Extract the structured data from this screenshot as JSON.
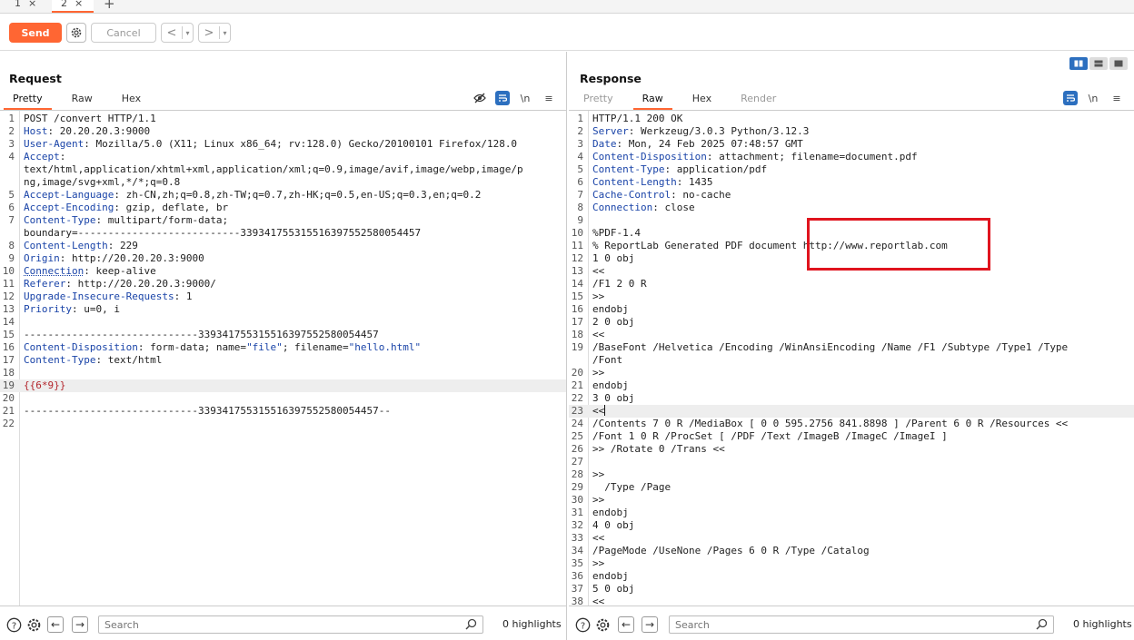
{
  "tabs": [
    {
      "label": "1",
      "close": "×"
    },
    {
      "label": "2",
      "close": "×"
    }
  ],
  "tab_add": "+",
  "toolbar": {
    "send_label": "Send",
    "cancel_label": "Cancel",
    "back_arrow": "<",
    "forward_arrow": ">",
    "dropdown": "▾"
  },
  "request": {
    "title": "Request",
    "tabs": [
      "Pretty",
      "Raw",
      "Hex"
    ],
    "newline_label": "\\n",
    "menu": "≡",
    "lines": [
      {
        "n": "1",
        "t": "POST /convert HTTP/1.1"
      },
      {
        "n": "2",
        "h": "Host",
        "v": ": 20.20.20.3:9000"
      },
      {
        "n": "3",
        "h": "User-Agent",
        "v": ": Mozilla/5.0 (X11; Linux x86_64; rv:128.0) Gecko/20100101 Firefox/128.0"
      },
      {
        "n": "4",
        "h": "Accept",
        "v": ":"
      },
      {
        "n": "",
        "t": "text/html,application/xhtml+xml,application/xml;q=0.9,image/avif,image/webp,image/p"
      },
      {
        "n": "",
        "t": "ng,image/svg+xml,*/*;q=0.8"
      },
      {
        "n": "5",
        "h": "Accept-Language",
        "v": ": zh-CN,zh;q=0.8,zh-TW;q=0.7,zh-HK;q=0.5,en-US;q=0.3,en;q=0.2"
      },
      {
        "n": "6",
        "h": "Accept-Encoding",
        "v": ": gzip, deflate, br"
      },
      {
        "n": "7",
        "h": "Content-Type",
        "v": ": multipart/form-data;"
      },
      {
        "n": "",
        "t": "boundary=---------------------------339341755315516397552580054457"
      },
      {
        "n": "8",
        "h": "Content-Length",
        "v": ": 229"
      },
      {
        "n": "9",
        "h": "Origin",
        "v": ": http://20.20.20.3:9000"
      },
      {
        "n": "10",
        "h": "Connection",
        "v": ": keep-alive",
        "u": true
      },
      {
        "n": "11",
        "h": "Referer",
        "v": ": http://20.20.20.3:9000/"
      },
      {
        "n": "12",
        "h": "Upgrade-Insecure-Requests",
        "v": ": 1"
      },
      {
        "n": "13",
        "h": "Priority",
        "v": ": u=0, i"
      },
      {
        "n": "14",
        "t": ""
      },
      {
        "n": "15",
        "t": "-----------------------------339341755315516397552580054457"
      },
      {
        "n": "16",
        "h": "Content-Disposition",
        "v": ": form-data; name=",
        "q1": "\"file\"",
        "v2": "; filename=",
        "q2": "\"hello.html\""
      },
      {
        "n": "17",
        "h": "Content-Type",
        "v": ": text/html"
      },
      {
        "n": "18",
        "t": ""
      },
      {
        "n": "19",
        "tm": "{{6*9}}",
        "hl": true
      },
      {
        "n": "20",
        "t": ""
      },
      {
        "n": "21",
        "t": "-----------------------------339341755315516397552580054457--"
      },
      {
        "n": "22",
        "t": ""
      }
    ],
    "search_placeholder": "Search",
    "highlights": "0 highlights"
  },
  "response": {
    "title": "Response",
    "tabs": [
      "Pretty",
      "Raw",
      "Hex",
      "Render"
    ],
    "newline_label": "\\n",
    "menu": "≡",
    "lines": [
      {
        "n": "1",
        "t": "HTTP/1.1 200 OK"
      },
      {
        "n": "2",
        "h": "Server",
        "v": ": Werkzeug/3.0.3 Python/3.12.3"
      },
      {
        "n": "3",
        "h": "Date",
        "v": ": Mon, 24 Feb 2025 07:48:57 GMT"
      },
      {
        "n": "4",
        "h": "Content-Disposition",
        "v": ": attachment; filename=document.pdf"
      },
      {
        "n": "5",
        "h": "Content-Type",
        "v": ": application/pdf"
      },
      {
        "n": "6",
        "h": "Content-Length",
        "v": ": 1435"
      },
      {
        "n": "7",
        "h": "Cache-Control",
        "v": ": no-cache"
      },
      {
        "n": "8",
        "h": "Connection",
        "v": ": close"
      },
      {
        "n": "9",
        "t": ""
      },
      {
        "n": "10",
        "t": "%PDF-1.4"
      },
      {
        "n": "11",
        "t": "% ReportLab Generated PDF document http://www.reportlab.com"
      },
      {
        "n": "12",
        "t": "1 0 obj"
      },
      {
        "n": "13",
        "t": "<<"
      },
      {
        "n": "14",
        "t": "/F1 2 0 R"
      },
      {
        "n": "15",
        "t": ">>"
      },
      {
        "n": "16",
        "t": "endobj"
      },
      {
        "n": "17",
        "t": "2 0 obj"
      },
      {
        "n": "18",
        "t": "<<"
      },
      {
        "n": "19",
        "t": "/BaseFont /Helvetica /Encoding /WinAnsiEncoding /Name /F1 /Subtype /Type1 /Type"
      },
      {
        "n": "",
        "t": "/Font"
      },
      {
        "n": "20",
        "t": ">>"
      },
      {
        "n": "21",
        "t": "endobj"
      },
      {
        "n": "22",
        "t": "3 0 obj"
      },
      {
        "n": "23",
        "t": "<<",
        "cursor": true,
        "hl": true
      },
      {
        "n": "24",
        "t": "/Contents 7 0 R /MediaBox [ 0 0 595.2756 841.8898 ] /Parent 6 0 R /Resources <<"
      },
      {
        "n": "25",
        "t": "/Font 1 0 R /ProcSet [ /PDF /Text /ImageB /ImageC /ImageI ]"
      },
      {
        "n": "26",
        "t": ">> /Rotate 0 /Trans <<"
      },
      {
        "n": "27",
        "t": ""
      },
      {
        "n": "28",
        "t": ">>"
      },
      {
        "n": "29",
        "t": "  /Type /Page"
      },
      {
        "n": "30",
        "t": ">>"
      },
      {
        "n": "31",
        "t": "endobj"
      },
      {
        "n": "32",
        "t": "4 0 obj"
      },
      {
        "n": "33",
        "t": "<<"
      },
      {
        "n": "34",
        "t": "/PageMode /UseNone /Pages 6 0 R /Type /Catalog"
      },
      {
        "n": "35",
        "t": ">>"
      },
      {
        "n": "36",
        "t": "endobj"
      },
      {
        "n": "37",
        "t": "5 0 obj"
      },
      {
        "n": "38",
        "t": "<<"
      }
    ],
    "search_placeholder": "Search",
    "highlights": "0 highlights"
  },
  "colors": {
    "accent": "#ff6633",
    "header_name": "#1a44a8",
    "template": "#b3262d",
    "highlight_box": "#e0141e",
    "toggle_active": "#2c6fbf"
  },
  "icons": {
    "settings": "gear-icon",
    "hide": "eye-slash-icon",
    "wrap": "wrap-icon",
    "help": "help-icon",
    "search": "search-icon"
  }
}
